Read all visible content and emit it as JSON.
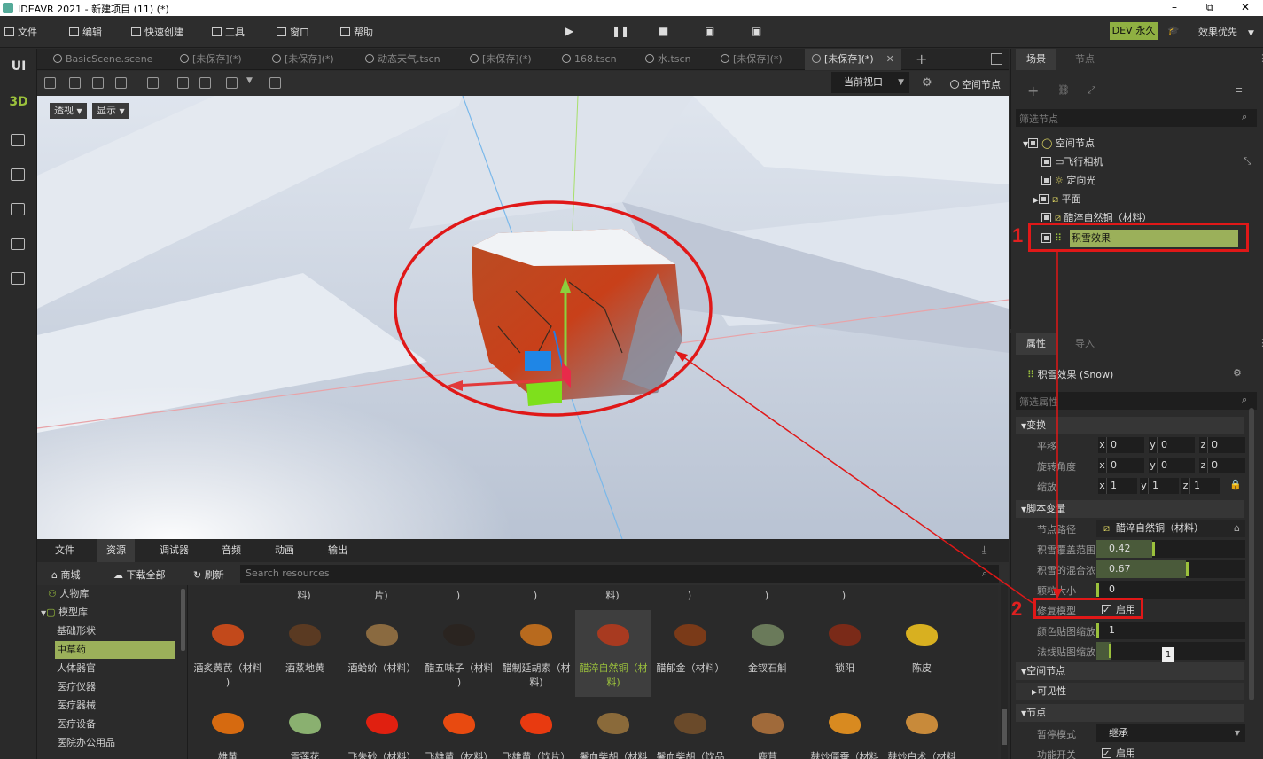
{
  "window": {
    "title": "IDEAVR 2021 - 新建项目 (11) (*)",
    "minimize": "–",
    "restore": "⧉",
    "close": "✕"
  },
  "menu": {
    "file": "文件",
    "edit": "编辑",
    "quick_create": "快速创建",
    "tools": "工具",
    "window": "窗口",
    "help": "帮助",
    "dev_badge": "DEV|永久",
    "quality": "效果优先"
  },
  "left_bar": {
    "ui": "UI",
    "three_d": "3D"
  },
  "tabs": [
    {
      "label": "BasicScene.scene"
    },
    {
      "label": "[未保存](*)"
    },
    {
      "label": "[未保存](*)"
    },
    {
      "label": "动态天气.tscn"
    },
    {
      "label": "[未保存](*)"
    },
    {
      "label": "168.tscn"
    },
    {
      "label": "水.tscn"
    },
    {
      "label": "[未保存](*)"
    },
    {
      "label": "[未保存](*)"
    }
  ],
  "viewport_toolbar": {
    "current_view": "当前视口",
    "space_node": "空间节点"
  },
  "viewport": {
    "perspective": "透视",
    "display": "显示"
  },
  "bottom_panel": {
    "tabs": [
      "文件",
      "资源",
      "调试器",
      "音频",
      "动画",
      "输出"
    ],
    "store": "商城",
    "download_all": "下载全部",
    "refresh": "刷新",
    "search_placeholder": "Search resources",
    "tree": {
      "people": "人物库",
      "model_lib": "模型库",
      "items": [
        "基础形状",
        "中草药",
        "人体器官",
        "医疗仪器",
        "医疗器械",
        "医疗设备",
        "医院办公用品"
      ]
    },
    "top_row_partial": [
      "料)",
      "片)",
      ")",
      ")",
      "料)",
      ")",
      ")",
      ")"
    ],
    "row1": [
      {
        "l1": "酒炙黄芪（材料",
        "l2": ")",
        "color": "#c2491b"
      },
      {
        "l1": "酒蒸地黄",
        "l2": "",
        "color": "#5a3a22"
      },
      {
        "l1": "酒蛤蚧（材料）",
        "l2": "",
        "color": "#8a6a40"
      },
      {
        "l1": "醋五味子（材料",
        "l2": ")",
        "color": "#2a2420"
      },
      {
        "l1": "醋制延胡索（材",
        "l2": "料)",
        "color": "#b86a1e"
      },
      {
        "l1": "醋淬自然铜（材",
        "l2": "料)",
        "color": "#a83a20"
      },
      {
        "l1": "醋郁金（材料）",
        "l2": "",
        "color": "#7a3a18"
      },
      {
        "l1": "金钗石斛",
        "l2": "",
        "color": "#6a7a5a"
      },
      {
        "l1": "锁阳",
        "l2": "",
        "color": "#7a2a18"
      },
      {
        "l1": "陈皮",
        "l2": "",
        "color": "#d8b020"
      }
    ],
    "row2": [
      {
        "l1": "雄黄",
        "color": "#d66a10"
      },
      {
        "l1": "雪莲花",
        "color": "#8ab070"
      },
      {
        "l1": "飞朱砂（材料）",
        "color": "#e02010"
      },
      {
        "l1": "飞雄黄（材料）",
        "color": "#e84a10"
      },
      {
        "l1": "飞雄黄（饮片）",
        "color": "#e83a10"
      },
      {
        "l1": "鬐血柴胡（材料",
        "color": "#8a6a3a"
      },
      {
        "l1": "鬐血柴胡（饮品",
        "color": "#6a4a2a"
      },
      {
        "l1": "鹿茸",
        "color": "#a06a3a"
      },
      {
        "l1": "麸炒僵蚕（材料",
        "color": "#d88a20"
      },
      {
        "l1": "麸炒白术（材料",
        "color": "#c88a3a"
      }
    ]
  },
  "scene_panel": {
    "tab_scene": "场景",
    "tab_node": "节点",
    "filter_placeholder": "筛选节点",
    "nodes": {
      "root": "空间节点",
      "camera": "飞行相机",
      "light": "定向光",
      "plane": "平面",
      "copper": "醋淬自然铜（材料）",
      "snow": "积雪效果"
    }
  },
  "props_panel": {
    "tab_props": "属性",
    "tab_import": "导入",
    "object_title": "积雪效果 (Snow)",
    "filter_placeholder": "筛选属性",
    "transform": "变换",
    "translate": "平移",
    "rotation": "旋转角度",
    "scale": "缩放",
    "t": {
      "x": "0",
      "y": "0",
      "z": "0"
    },
    "r": {
      "x": "0",
      "y": "0",
      "z": "0"
    },
    "s": {
      "x": "1",
      "y": "1",
      "z": "1"
    },
    "script_vars": "脚本变量",
    "node_path": "节点路径",
    "node_path_value": "醋淬自然铜（材料）",
    "snow_coverage": "积雪覆盖范围",
    "snow_coverage_value": 0.42,
    "snow_coverage_text": "0.42",
    "snow_blend": "积雪的混合浓",
    "snow_blend_value": 0.67,
    "snow_blend_text": "0.67",
    "particle_size": "颗粒大小",
    "particle_size_value": "0",
    "repair_model": "修复模型",
    "repair_model_value": "启用",
    "color_tex_scale": "颜色贴图缩放",
    "color_tex_scale_value": "1",
    "normal_tex_scale": "法线贴图缩放",
    "tooltip": "1",
    "space_node": "空间节点",
    "visibility": "可见性",
    "node": "节点",
    "pause_mode": "暂停模式",
    "pause_mode_value": "继承",
    "feature_switch": "功能开关",
    "feature_switch_value": "启用"
  },
  "annotations": {
    "one": "1",
    "two": "2"
  }
}
